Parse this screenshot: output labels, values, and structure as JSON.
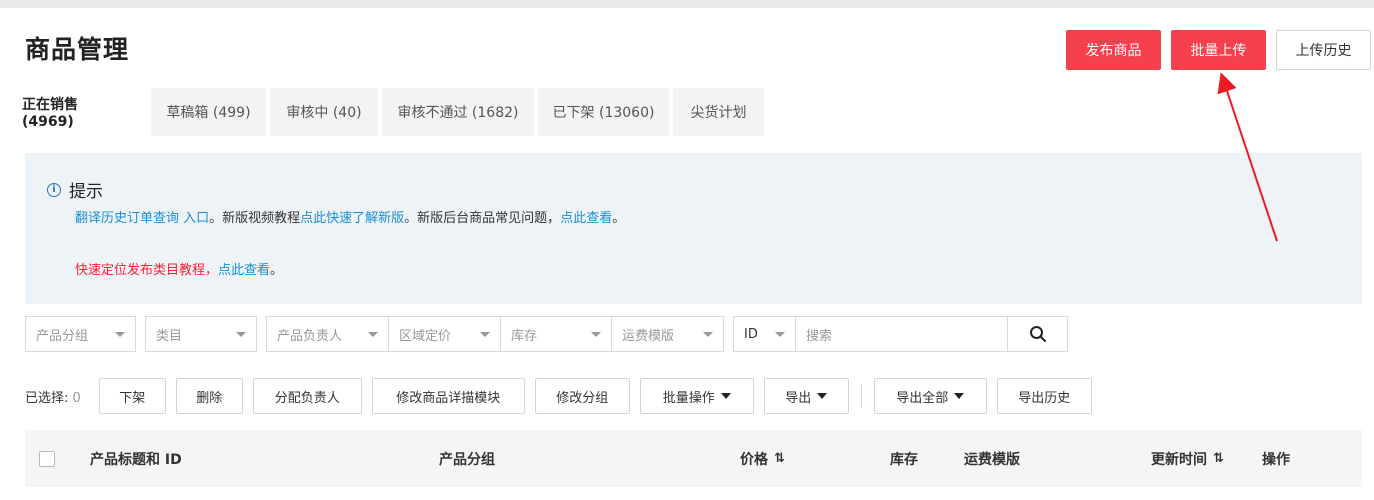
{
  "page_title": "商品管理",
  "header_buttons": {
    "publish": "发布商品",
    "batch_upload": "批量上传",
    "upload_history": "上传历史"
  },
  "tabs": [
    {
      "label": "正在销售 (4969)",
      "active": true
    },
    {
      "label": "草稿箱 (499)"
    },
    {
      "label": "审核中 (40)"
    },
    {
      "label": "审核不通过 (1682)"
    },
    {
      "label": "已下架 (13060)"
    },
    {
      "label": "尖货计划"
    }
  ],
  "notice": {
    "title": "提示",
    "line1": {
      "link_a": "翻译历史订单查询 入口",
      "text_b": "。新版视频教程",
      "link_c": "点此快速了解新版",
      "text_d": "。新版后台商品常见问题，",
      "link_e": "点此查看",
      "text_f": "。"
    },
    "line2": {
      "red_a": "快速定位发布类目教程，",
      "link_b": "点此查看",
      "text_c": "。"
    }
  },
  "filters": {
    "product_group": "产品分组",
    "category": "类目",
    "owner": "产品负责人",
    "regional_price": "区域定价",
    "inventory": "库存",
    "shipping_template": "运费模版",
    "id_select": "ID",
    "search_placeholder": "搜索"
  },
  "actions": {
    "selected_label": "已选择:",
    "selected_count": "0",
    "delist": "下架",
    "delete": "删除",
    "assign_owner": "分配负责人",
    "edit_detail_module": "修改商品详描模块",
    "edit_group": "修改分组",
    "batch_ops": "批量操作",
    "export": "导出",
    "export_all": "导出全部",
    "export_history": "导出历史"
  },
  "table_header": {
    "title_id": "产品标题和 ID",
    "group": "产品分组",
    "price": "价格",
    "inventory": "库存",
    "shipping": "运费模版",
    "updated": "更新时间",
    "operation": "操作"
  },
  "colors": {
    "primary_red": "#f5414d",
    "link_blue": "#1b8fd6",
    "warning_red": "#ff1e2e",
    "notice_bg": "#eef3f8"
  }
}
